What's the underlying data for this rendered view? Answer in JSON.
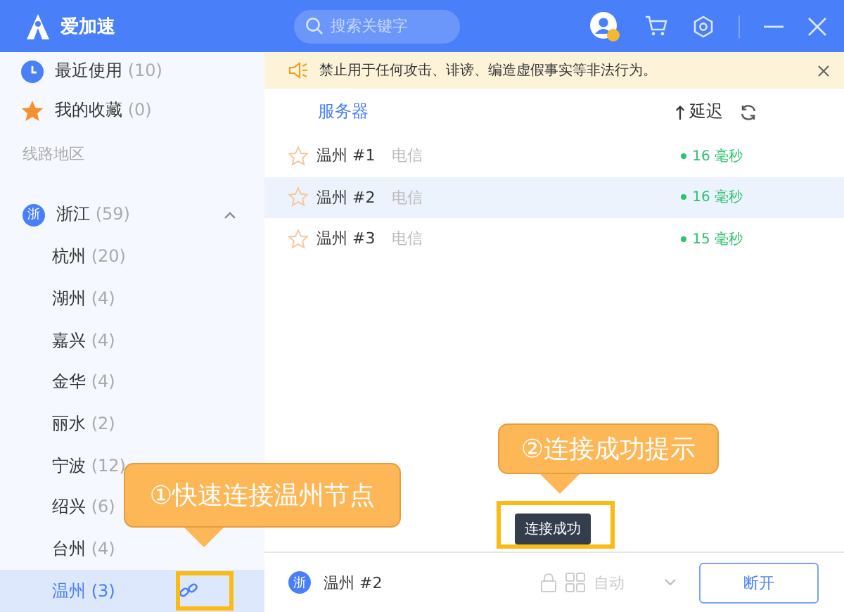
{
  "header": {
    "app_name": "爱加速",
    "search_placeholder": "搜索关键字"
  },
  "sidebar": {
    "quick": [
      {
        "kind": "recent",
        "label": "最近使用",
        "count": "(10)"
      },
      {
        "kind": "favorites",
        "label": "我的收藏",
        "count": "(0)"
      }
    ],
    "section_label": "线路地区",
    "regions": [
      {
        "badge": "浙",
        "name": "浙江",
        "count": "(59)",
        "expanded": true,
        "children": [
          {
            "name": "杭州",
            "count": "(20)",
            "selected": false
          },
          {
            "name": "湖州",
            "count": "(4)",
            "selected": false
          },
          {
            "name": "嘉兴",
            "count": "(4)",
            "selected": false
          },
          {
            "name": "金华",
            "count": "(4)",
            "selected": false
          },
          {
            "name": "丽水",
            "count": "(2)",
            "selected": false
          },
          {
            "name": "宁波",
            "count": "(12)",
            "selected": false
          },
          {
            "name": "绍兴",
            "count": "(6)",
            "selected": false
          },
          {
            "name": "台州",
            "count": "(4)",
            "selected": false
          },
          {
            "name": "温州",
            "count": "(3)",
            "selected": true
          }
        ]
      }
    ]
  },
  "notice": "禁止用于任何攻击、诽谤、编造虚假事实等非法行为。",
  "servers": {
    "column_server": "服务器",
    "column_latency": "延迟",
    "rows": [
      {
        "name": "温州 #1",
        "isp": "电信",
        "latency": "16 毫秒",
        "selected": false
      },
      {
        "name": "温州 #2",
        "isp": "电信",
        "latency": "16 毫秒",
        "selected": true
      },
      {
        "name": "温州 #3",
        "isp": "电信",
        "latency": "15 毫秒",
        "selected": false
      }
    ]
  },
  "connection": {
    "badge": "浙",
    "server": "温州 #2",
    "mode": "自动",
    "mode_disabled": true,
    "button": "断开"
  },
  "toast": "连接成功",
  "annotations": [
    "①快速连接温州节点",
    "②连接成功提示"
  ]
}
